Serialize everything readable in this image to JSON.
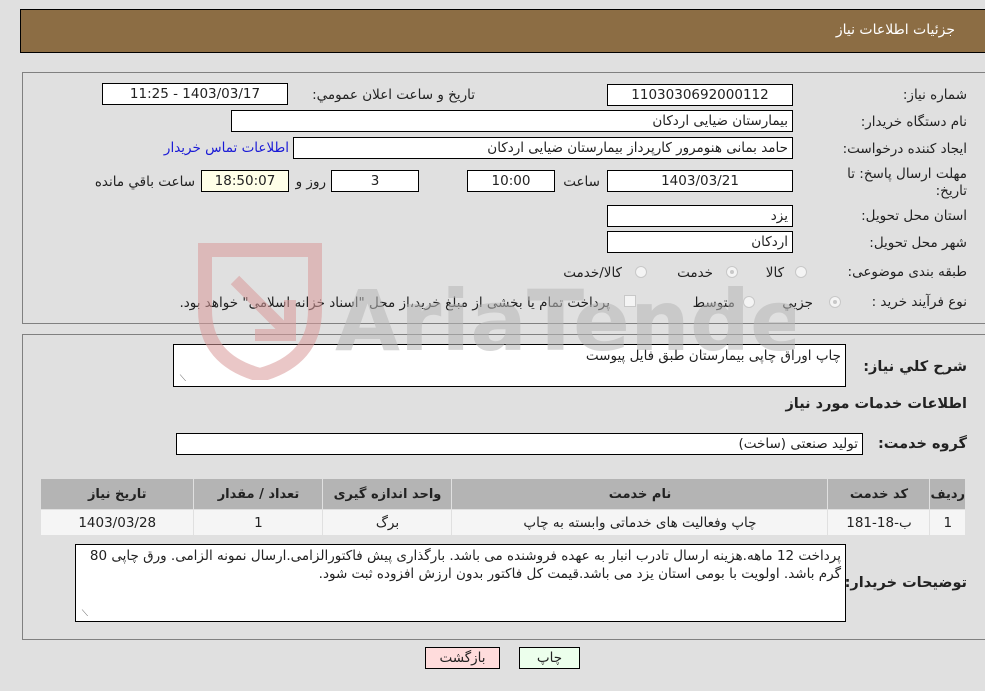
{
  "header": {
    "title": "جزئیات اطلاعات نیاز"
  },
  "details": {
    "need_number": {
      "label": "شماره نیاز:",
      "value": "1103030692000112"
    },
    "announce_datetime": {
      "label": "تاریخ و ساعت اعلان عمومي:",
      "value": "1403/03/17 - 11:25"
    },
    "buyer_org": {
      "label": "نام دستگاه خریدار:",
      "value": "بیمارستان ضیایی اردکان"
    },
    "requester": {
      "label": "ایجاد کننده درخواست:",
      "value": "حامد بمانی هنومرور کارپرداز بیمارستان ضیایی اردکان"
    },
    "buyer_contact_link": "اطلاعات تماس خریدار",
    "deadline": {
      "label": "مهلت ارسال پاسخ: تا تاریخ:",
      "date": "1403/03/21",
      "time_label": "ساعت",
      "time": "10:00",
      "days": "3",
      "days_label": "روز و",
      "remaining": "18:50:07",
      "remaining_label": "ساعت باقي مانده"
    },
    "province": {
      "label": "استان محل تحویل:",
      "value": "یزد"
    },
    "city": {
      "label": "شهر محل تحویل:",
      "value": "اردکان"
    },
    "category": {
      "label": "طبقه بندی موضوعی:",
      "options": [
        "کالا",
        "خدمت",
        "کالا/خدمت"
      ],
      "selected": "خدمت"
    },
    "purchase_type": {
      "label": "نوع فرآیند خرید :",
      "options": [
        "جزیي",
        "متوسط"
      ],
      "selected": "جزیي",
      "treasury_note": "پرداخت تمام یا بخشی از مبلغ خرید،از محل \"اسناد خزانه اسلامی\" خواهد بود."
    }
  },
  "services": {
    "summary_label": "شرح كلي نیاز:",
    "summary_value": "چاپ اوراق چاپی بیمارستان طبق فایل پیوست",
    "section_title": "اطلاعات خدمات مورد نیاز",
    "group_label": "گروه خدمت:",
    "group_value": "تولید صنعتی (ساخت)",
    "table": {
      "headers": [
        "ردیف",
        "کد خدمت",
        "نام خدمت",
        "واحد اندازه گیری",
        "تعداد / مقدار",
        "تاریخ نیاز"
      ],
      "rows": [
        [
          "1",
          "ب-18-181",
          "چاپ وفعالیت های خدماتی وابسته به چاپ",
          "برگ",
          "1",
          "1403/03/28"
        ]
      ]
    },
    "buyer_notes_label": "توضیحات خریدار:",
    "buyer_notes": "پرداخت 12 ماهه.هزینه ارسال تادرب انبار به عهده فروشنده می باشد. بارگذاری پیش فاکتورالزامی.ارسال نمونه الزامی. ورق چاپی 80 گرم باشد. اولویت با بومی استان یزد می باشد.قیمت کل فاکتور بدون ارزش افزوده ثبت شود."
  },
  "buttons": {
    "print": "چاپ",
    "back": "بازگشت"
  },
  "watermark": "AriaTender.neT"
}
